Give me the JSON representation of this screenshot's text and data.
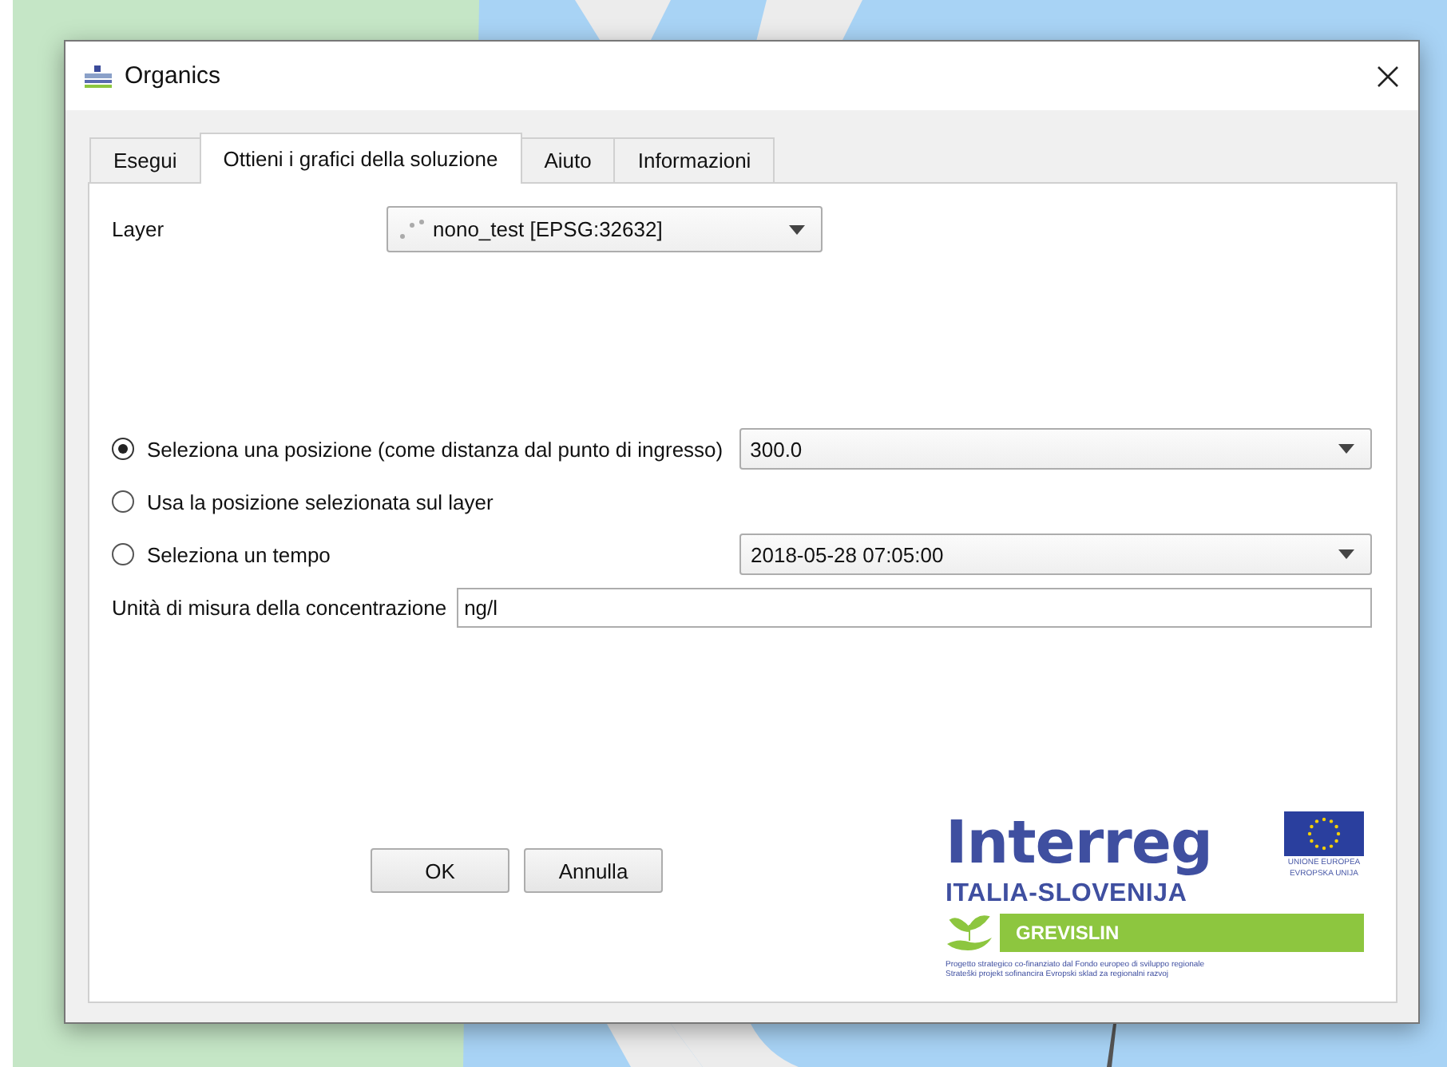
{
  "window": {
    "title": "Organics"
  },
  "tabs": [
    {
      "label": "Esegui",
      "selected": false
    },
    {
      "label": "Ottieni i grafici della soluzione",
      "selected": true
    },
    {
      "label": "Aiuto",
      "selected": false
    },
    {
      "label": "Informazioni",
      "selected": false
    }
  ],
  "layer": {
    "label": "Layer",
    "value": "nono_test [EPSG:32632]"
  },
  "options": [
    {
      "label": "Seleziona una posizione (come distanza dal punto di ingresso)",
      "selected": true,
      "value": "300.0"
    },
    {
      "label": "Usa la posizione selezionata sul layer",
      "selected": false
    },
    {
      "label": "Seleziona un tempo",
      "selected": false,
      "value": "2018-05-28 07:05:00"
    }
  ],
  "unit": {
    "label": "Unità di misura della concentrazione",
    "value": "ng/l"
  },
  "buttons": [
    "OK",
    "Annulla"
  ],
  "logo": {
    "name": "Interreg",
    "eu_lines": [
      "UNIONE EUROPEA",
      "EVROPSKA UNIJA"
    ],
    "region": "ITALIA-SLOVENIJA",
    "project": "GREVISLIN",
    "footer": [
      "Progetto strategico co-finanziato dal Fondo europeo di sviluppo regionale",
      "Strateški projekt sofinancira Evropski sklad za regionalni razvoj"
    ]
  }
}
